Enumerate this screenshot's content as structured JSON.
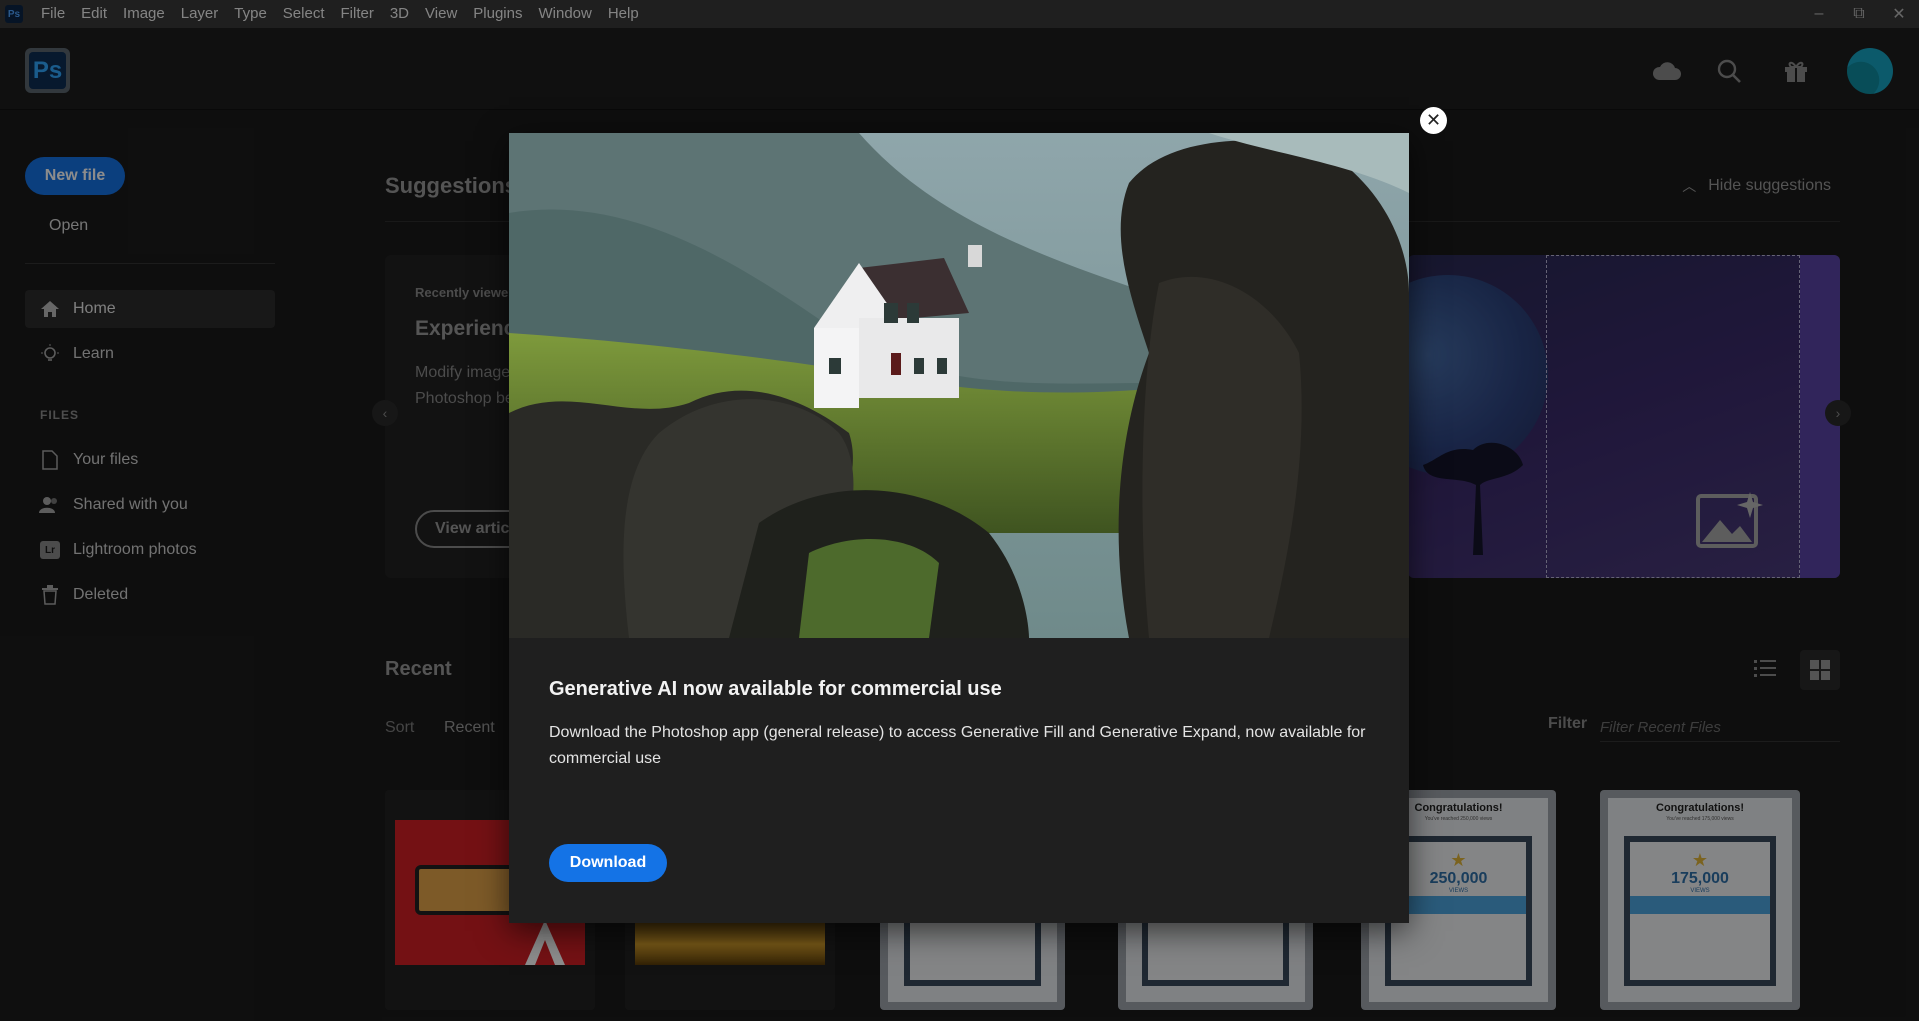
{
  "menubar": {
    "app_badge": "Ps",
    "items": [
      "File",
      "Edit",
      "Image",
      "Layer",
      "Type",
      "Select",
      "Filter",
      "3D",
      "View",
      "Plugins",
      "Window",
      "Help"
    ],
    "window_controls": {
      "minimize": "–",
      "restore": "⧉",
      "close": "✕"
    }
  },
  "appbar": {
    "logo": "Ps",
    "icons": [
      "cloud-icon",
      "search-icon",
      "gift-icon"
    ]
  },
  "sidebar": {
    "new_file": "New file",
    "open": "Open",
    "home": "Home",
    "learn": "Learn",
    "section_files": "FILES",
    "your_files": "Your files",
    "shared": "Shared with you",
    "lightroom_badge": "Lr",
    "lightroom": "Lightroom photos",
    "deleted": "Deleted"
  },
  "suggestions": {
    "title": "Suggestions",
    "hide": "Hide suggestions",
    "card": {
      "small": "Recently viewe",
      "title": "Experienc",
      "desc": "Modify image\nPhotoshop be",
      "button": "View artic"
    }
  },
  "recent": {
    "title": "Recent",
    "sort_label": "Sort",
    "sort_value": "Recent",
    "filter_label": "Filter",
    "filter_placeholder": "Filter Recent Files"
  },
  "thumbs": {
    "cert5": {
      "title": "Congratulations!",
      "sub": "You've reached 250,000 views",
      "num": "250,000",
      "views": "VIEWS"
    },
    "cert6": {
      "title": "Congratulations!",
      "sub": "You've reached 175,000 views",
      "num": "175,000",
      "views": "VIEWS"
    }
  },
  "modal": {
    "title": "Generative AI now available for commercial use",
    "body": "Download the Photoshop app (general release) to access Generative Fill and Generative Expand, now available for commercial use",
    "download": "Download",
    "close": "✕"
  },
  "colors": {
    "accent": "#1473e6",
    "background": "#1b1b1b",
    "modal": "#1f1f1f"
  }
}
